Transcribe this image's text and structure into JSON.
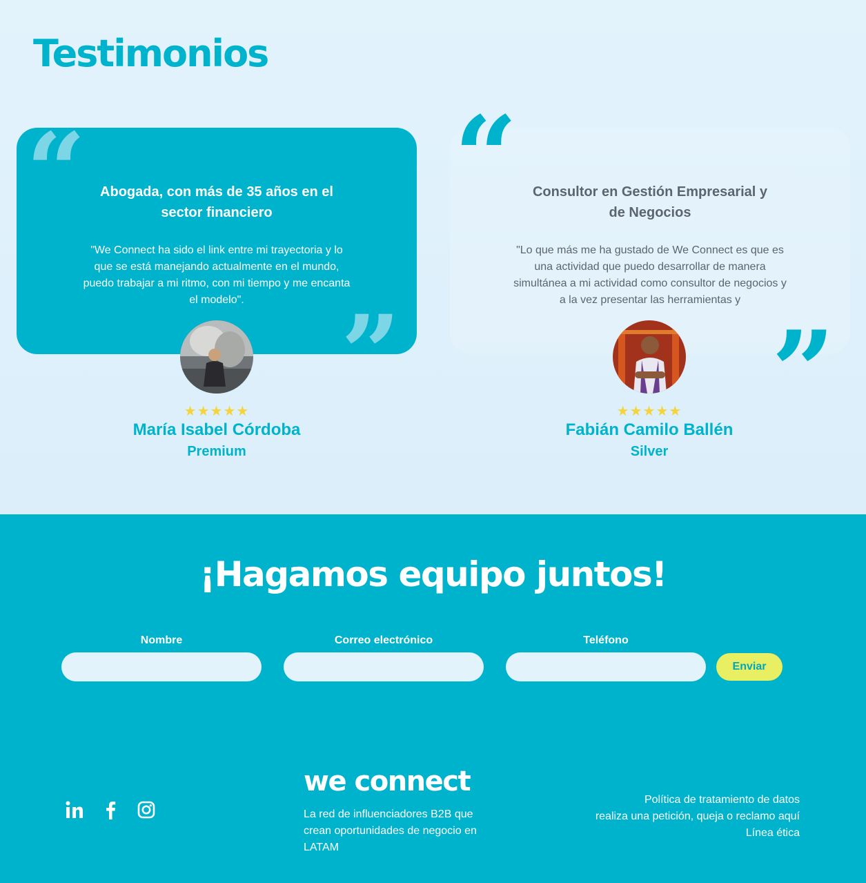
{
  "colors": {
    "accent": "#00b3cc",
    "background_light": "#e3f3fc",
    "button": "#e8ef63",
    "stars": "#f5d33b",
    "muted_text": "#5b6470"
  },
  "testimonials": {
    "title": "Testimonios",
    "items": [
      {
        "role": "Abogada, con más de 35 años en el sector financiero",
        "quote": "\"We Connect ha sido el link entre mi trayectoria y lo que se está manejando actualmente en el mundo, puedo trabajar a mi ritmo, con mi tiempo y me encanta el modelo\".",
        "name": "María Isabel Córdoba",
        "tier": "Premium",
        "rating": 5,
        "stars": "★★★★★"
      },
      {
        "role": "Consultor en Gestión Empresarial y de Negocios",
        "quote": "\"Lo que más me ha gustado de We Connect es que es una actividad que puedo desarrollar de manera simultánea a mi actividad como consultor de negocios y a la vez presentar las herramientas y",
        "name": "Fabián Camilo Ballén",
        "tier": "Silver",
        "rating": 5,
        "stars": "★★★★★"
      }
    ]
  },
  "cta": {
    "title": "¡Hagamos equipo juntos!",
    "fields": [
      {
        "label": "Nombre",
        "value": ""
      },
      {
        "label": "Correo electrónico",
        "value": ""
      },
      {
        "label": "Teléfono",
        "value": ""
      }
    ],
    "submit_label": "Enviar"
  },
  "footer": {
    "socials": [
      "linkedin-icon",
      "facebook-icon",
      "instagram-icon"
    ],
    "brand": "we connect",
    "tagline": "La red de influenciadores B2B que crean oportunidades de negocio en LATAM",
    "links": [
      "Política de tratamiento de datos",
      "realiza una petición, queja o reclamo aquí",
      "Línea ética"
    ]
  }
}
